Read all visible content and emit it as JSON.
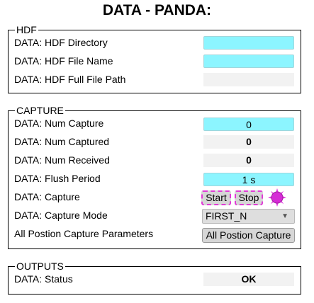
{
  "page": {
    "title": "DATA - PANDA:"
  },
  "hdf": {
    "legend": "HDF",
    "rows": {
      "directory": {
        "label": "DATA: HDF Directory",
        "value": ""
      },
      "file_name": {
        "label": "DATA: HDF File Name",
        "value": ""
      },
      "full_path": {
        "label": "DATA: HDF Full File Path",
        "value": ""
      }
    }
  },
  "capture": {
    "legend": "CAPTURE",
    "rows": {
      "num_capture": {
        "label": "DATA: Num Capture",
        "value": "0"
      },
      "num_captured": {
        "label": "DATA: Num Captured",
        "value": "0"
      },
      "num_received": {
        "label": "DATA: Num Received",
        "value": "0"
      },
      "flush_period": {
        "label": "DATA: Flush Period",
        "value": "1 s"
      },
      "capture": {
        "label": "DATA: Capture",
        "start_label": "Start",
        "stop_label": "Stop",
        "led_color": "#d62bd6"
      },
      "capture_mode": {
        "label": "DATA: Capture Mode",
        "value": "FIRST_N"
      },
      "all_position": {
        "label": "All Postion Capture Parameters",
        "button_label": "All Postion Capture"
      }
    }
  },
  "outputs": {
    "legend": "OUTPUTS",
    "rows": {
      "status": {
        "label": "DATA: Status",
        "value": "OK"
      }
    }
  },
  "colors": {
    "input_bg": "#8cf5ff",
    "readonly_bg": "#f2f2f2",
    "button_bg": "#d6d6d6",
    "button_dashed_border": "#e03bd6"
  }
}
